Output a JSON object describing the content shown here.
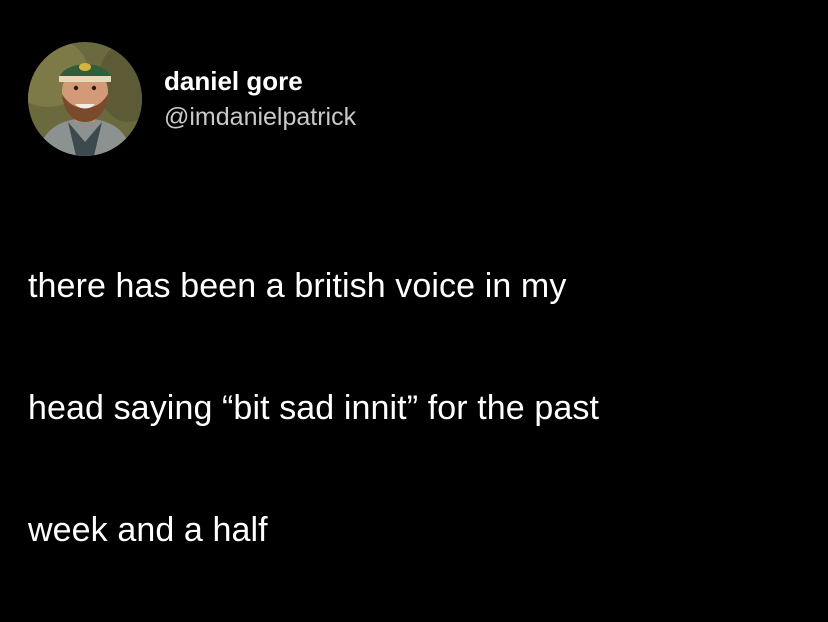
{
  "tweet": {
    "author": {
      "display_name": "daniel gore",
      "handle": "@imdanielpatrick",
      "avatar_icon": "profile-photo-avatar"
    },
    "text_lines": [
      "there has been a british voice in my",
      "head saying “bit sad innit” for the past",
      "week and a half"
    ]
  },
  "colors": {
    "background": "#000000",
    "text": "#ffffff",
    "handle": "#c9c9c9"
  }
}
